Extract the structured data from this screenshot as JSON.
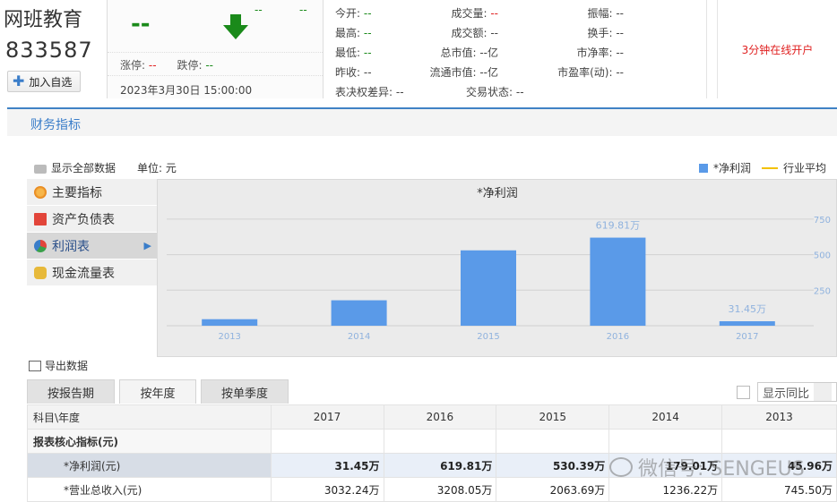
{
  "header": {
    "stock_name": "网班教育",
    "stock_code": "833587",
    "add_watchlist": "加入自选",
    "price": "--",
    "change": "--",
    "change_pct": "--",
    "limit_up_label": "涨停:",
    "limit_up": "--",
    "limit_down_label": "跌停:",
    "limit_down": "--",
    "datetime": "2023年3月30日 15:00:00",
    "open_account": "3分钟在线开户"
  },
  "quotes": [
    {
      "label": "今开:",
      "value": "--",
      "color": "green"
    },
    {
      "label": "成交量:",
      "value": "--",
      "color": "red"
    },
    {
      "label": "振幅:",
      "value": "--",
      "color": "gray"
    },
    {
      "label": "最高:",
      "value": "--",
      "color": "green"
    },
    {
      "label": "成交额:",
      "value": "--",
      "color": "gray"
    },
    {
      "label": "换手:",
      "value": "--",
      "color": "gray"
    },
    {
      "label": "最低:",
      "value": "--",
      "color": "green"
    },
    {
      "label": "总市值:",
      "value": "--亿",
      "color": "gray"
    },
    {
      "label": "市净率:",
      "value": "--",
      "color": "gray"
    },
    {
      "label": "昨收:",
      "value": "--",
      "color": "gray"
    },
    {
      "label": "流通市值:",
      "value": "--亿",
      "color": "gray"
    },
    {
      "label": "市盈率(动):",
      "value": "--",
      "color": "gray"
    },
    {
      "label": "表决权差异:",
      "value": "--",
      "color": "gray"
    },
    {
      "label": "交易状态:",
      "value": "--",
      "color": "gray"
    }
  ],
  "section": {
    "title": "财务指标",
    "show_all": "显示全部数据",
    "unit": "单位: 元",
    "legend_series": "*净利润",
    "legend_avg": "行业平均"
  },
  "menu": [
    {
      "label": "主要指标",
      "icon": "gear-icon",
      "active": false
    },
    {
      "label": "资产负债表",
      "icon": "document-icon",
      "active": false
    },
    {
      "label": "利润表",
      "icon": "pie-chart-icon",
      "active": true
    },
    {
      "label": "现金流量表",
      "icon": "coins-icon",
      "active": false
    }
  ],
  "chart_data": {
    "type": "bar",
    "title": "*净利润",
    "categories": [
      "2013",
      "2014",
      "2015",
      "2016",
      "2017"
    ],
    "values": [
      45.96,
      179.01,
      530.39,
      619.81,
      31.45
    ],
    "data_labels": [
      "",
      "",
      "",
      "619.81万",
      "31.45万"
    ],
    "ytick_labels": [
      "250",
      "500",
      "750"
    ],
    "ytick_values": [
      250,
      500,
      750
    ],
    "ylim": [
      0,
      850
    ],
    "bar_color": "#5a9ae8",
    "grid": true
  },
  "export_label": "导出数据",
  "tabs": [
    "按报告期",
    "按年度",
    "按单季度"
  ],
  "active_tab": 1,
  "yoy_label": "显示同比",
  "table": {
    "header": [
      "科目\\年度",
      "2017",
      "2016",
      "2015",
      "2014",
      "2013"
    ],
    "group_label": "报表核心指标(元)",
    "rows": [
      {
        "label": "*净利润(元)",
        "values": [
          "31.45万",
          "619.81万",
          "530.39万",
          "179.01万",
          "45.96万"
        ]
      },
      {
        "label": "*营业总收入(元)",
        "values": [
          "3032.24万",
          "3208.05万",
          "2063.69万",
          "1236.22万",
          "745.50万"
        ]
      }
    ]
  },
  "watermark": "微信号: SENGEUS"
}
